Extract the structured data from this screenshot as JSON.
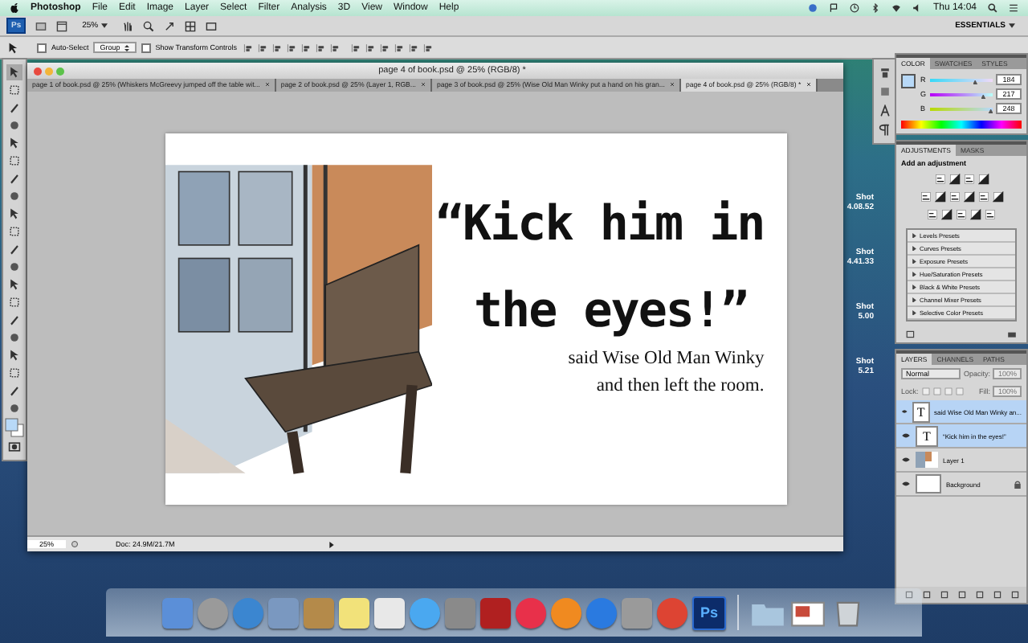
{
  "menubar": {
    "app": "Photoshop",
    "menus": [
      "File",
      "Edit",
      "Image",
      "Layer",
      "Select",
      "Filter",
      "Analysis",
      "3D",
      "View",
      "Window",
      "Help"
    ],
    "clock": "Thu 14:04"
  },
  "app_bar": {
    "logo": "Ps",
    "zoom": "25%",
    "workspace": "ESSENTIALS"
  },
  "options_bar": {
    "auto_select": {
      "label": "Auto-Select",
      "checked": false
    },
    "mode": "Group",
    "transform": {
      "label": "Show Transform Controls",
      "checked": false
    }
  },
  "tools": [
    {
      "selected": true
    },
    {
      "selected": false
    },
    {
      "selected": false
    },
    {
      "selected": false
    },
    {
      "selected": false
    },
    {
      "selected": false
    },
    {
      "selected": false
    },
    {
      "selected": false
    },
    {
      "selected": false
    },
    {
      "selected": false
    },
    {
      "selected": false
    },
    {
      "selected": false
    },
    {
      "selected": false
    },
    {
      "selected": false
    },
    {
      "selected": false
    },
    {
      "selected": false
    },
    {
      "selected": false
    },
    {
      "selected": false
    },
    {
      "selected": false
    },
    {
      "selected": false
    }
  ],
  "document": {
    "title": "page 4 of book.psd @ 25% (RGB/8) *",
    "tabs": [
      {
        "label": "page 1 of book.psd @ 25% (Whiskers McGreevy jumped off the table wit...",
        "selected": false
      },
      {
        "label": "page 2 of book.psd @ 25% (Layer 1, RGB...",
        "selected": false
      },
      {
        "label": "page 3 of book.psd @ 25% (Wise Old Man Winky put a hand on  his gran...",
        "selected": false
      },
      {
        "label": "page 4 of book.psd @ 25% (RGB/8) *",
        "selected": true
      }
    ],
    "quote": [
      "“Kick him in",
      "the eyes!”"
    ],
    "caption": [
      "said Wise Old Man Winky",
      "and then left the room."
    ],
    "status_zoom": "25%",
    "status_doc": "Doc: 24.9M/21.7M"
  },
  "desktop_labels": [
    [
      "Shot",
      "4.08.52"
    ],
    [
      "Shot",
      "4.41.33"
    ],
    [
      "Shot",
      "5.00"
    ],
    [
      "Shot",
      "5.21"
    ]
  ],
  "color_panel": {
    "tabs": [
      {
        "label": "COLOR",
        "selected": true
      },
      {
        "label": "SWATCHES",
        "selected": false
      },
      {
        "label": "STYLES",
        "selected": false
      }
    ],
    "sliders": [
      {
        "label": "R",
        "value": "184",
        "level": 0.72
      },
      {
        "label": "G",
        "value": "217",
        "level": 0.85
      },
      {
        "label": "B",
        "value": "248",
        "level": 0.97
      }
    ]
  },
  "adjustments_panel": {
    "tabs": [
      {
        "label": "ADJUSTMENTS",
        "selected": true
      },
      {
        "label": "MASKS",
        "selected": false
      }
    ],
    "heading": "Add an adjustment",
    "presets": [
      "Levels Presets",
      "Curves Presets",
      "Exposure Presets",
      "Hue/Saturation Presets",
      "Black & White Presets",
      "Channel Mixer Presets",
      "Selective Color Presets"
    ]
  },
  "layers_panel": {
    "tabs": [
      {
        "label": "LAYERS",
        "selected": true
      },
      {
        "label": "CHANNELS",
        "selected": false
      },
      {
        "label": "PATHS",
        "selected": false
      }
    ],
    "blend": "Normal",
    "opacity_label": "Opacity:",
    "opacity": "100%",
    "lock_label": "Lock:",
    "fill_label": "Fill:",
    "fill": "100%",
    "layers": [
      {
        "name": "said Wise Old Man Winky an...",
        "kind": "text",
        "thumbnail_label": "T",
        "selected": true
      },
      {
        "name": "“Kick him in  the eyes!”",
        "kind": "text",
        "thumbnail_label": "T",
        "selected": true
      },
      {
        "name": "Layer 1",
        "kind": "image",
        "selected": false
      },
      {
        "name": "Background",
        "kind": "background",
        "selected": false
      }
    ]
  },
  "dock": {
    "ps_label": "Ps"
  }
}
